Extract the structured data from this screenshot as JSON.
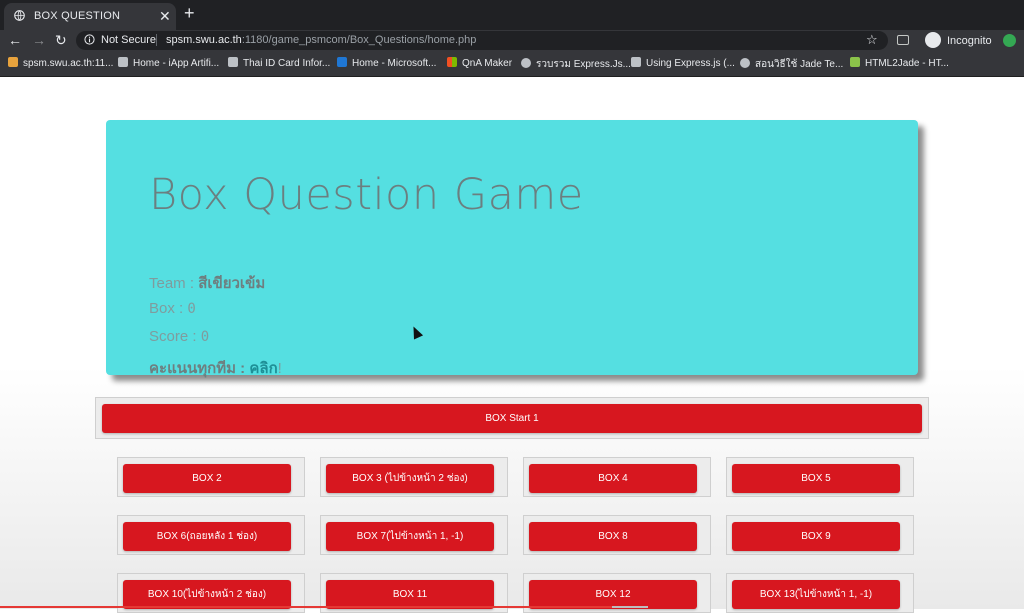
{
  "browser": {
    "tab_title": "BOX QUESTION",
    "tab_close": "✕",
    "new_tab": "+",
    "back": "←",
    "forward": "→",
    "reload": "↻",
    "security_label": "Not Secure",
    "url_host": "spsm.swu.ac.th",
    "url_path": ":1180/game_psmcom/Box_Questions/home.php",
    "star": "☆",
    "incognito_label": "Incognito",
    "bookmarks": [
      "spsm.swu.ac.th:11...",
      "Home - iApp Artifi...",
      "Thai ID Card Infor...",
      "Home - Microsoft...",
      "QnA Maker",
      "รวบรวม Express.Js...",
      "Using Express.js (...",
      "สอนวิธีใช้ Jade Te...",
      "HTML2Jade - HT..."
    ]
  },
  "hero": {
    "title": "Box Question Game",
    "team_label": "Team : ",
    "team_value": "สีเขียวเข้ม",
    "box_label": "Box : ",
    "box_value": "0",
    "score_label": "Score : ",
    "score_value": "0",
    "all_scores_label": "คะแนนทุกทีม : ",
    "all_scores_link": "คลิก",
    "all_scores_suffix": "!"
  },
  "start_box": "BOX Start 1",
  "boxes": [
    "BOX 2",
    "BOX 3 (ไปข้างหน้า 2 ช่อง)",
    "BOX 4",
    "BOX 5",
    "BOX 6(ถอยหลัง 1 ช่อง)",
    "BOX 7(ไปข้างหน้า 1, -1)",
    "BOX 8",
    "BOX 9",
    "BOX 10(ไปข้างหน้า 2 ช่อง)",
    "BOX 11",
    "BOX 12",
    "BOX 13(ไปข้างหน้า 1, -1)"
  ],
  "video_progress": 0.6,
  "colors": {
    "hero_bg": "#55dfe1",
    "button_red": "#d7171f"
  }
}
